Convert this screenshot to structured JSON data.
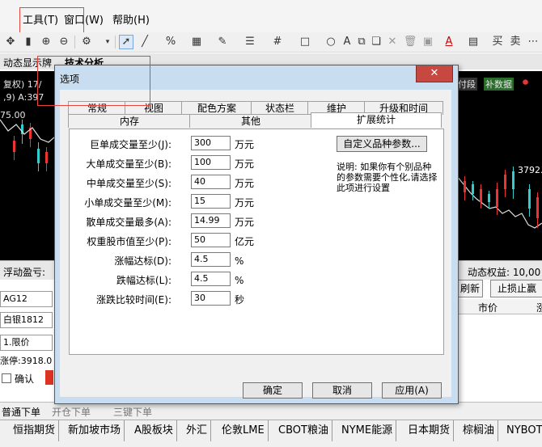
{
  "menu": {
    "tools": "工具(T)",
    "window": "窗口(W)",
    "help": "帮助(H)"
  },
  "toolbar": {
    "buttons": [
      "move-icon",
      "bars-icon",
      "zoom-in-icon",
      "zoom-out-icon",
      "settings-icon",
      "cursor-icon",
      "line-icon",
      "percent-icon",
      "ruler-icon",
      "pen-icon",
      "horizontal-lines-icon",
      "grid-icon",
      "rectangle-icon",
      "circle-icon",
      "text-icon",
      "copy-icon",
      "delete-icon",
      "trash-icon",
      "font-color-icon",
      "save-icon"
    ],
    "right_labels": [
      "买",
      "卖"
    ]
  },
  "app_tabs": {
    "dynamic": "动态显示牌",
    "technical": "技术分析"
  },
  "chart": {
    "header_left": "复权) 17/",
    "header_left2": ",9) A:397",
    "price_left": "75.00",
    "price_right": "3792.",
    "right_badge1": "付段",
    "right_badge2": "补数据"
  },
  "trade_panel": {
    "floating_pnl": "浮动盈亏:",
    "dynamic_equity": "动态权益: 10,00",
    "contract": "AG12",
    "contract_name": "白银1812",
    "order_type": "1.限价",
    "limit_down": "涨停:3918.0",
    "confirm": "确认",
    "refresh": "刷新",
    "stop_loss": "止损止赢",
    "col_market": "市价",
    "col_extra": "涨",
    "bottom_tab_normal": "普通下单",
    "bottom_tab2": "开仓下单",
    "bottom_tab3": "三键下单"
  },
  "market_tabs": [
    "恒指期货",
    "新加坡市场",
    "A股板块",
    "外汇",
    "伦敦LME",
    "CBOT粮油",
    "NYME能源",
    "日本期货",
    "棕榈油",
    "NYBOT"
  ],
  "dialog": {
    "title": "选项",
    "close": "✕",
    "tabs_row1": [
      "常规",
      "视图",
      "配色方案",
      "状态栏",
      "维护",
      "升级和时间"
    ],
    "tabs_row2": [
      "内存",
      "其他",
      "扩展统计"
    ],
    "active_tab": "扩展统计",
    "fields": [
      {
        "label": "巨单成交量至少(J):",
        "value": "300",
        "unit": "万元"
      },
      {
        "label": "大单成交量至少(B):",
        "value": "100",
        "unit": "万元"
      },
      {
        "label": "中单成交量至少(S):",
        "value": "40",
        "unit": "万元"
      },
      {
        "label": "小单成交量至少(M):",
        "value": "15",
        "unit": "万元"
      },
      {
        "label": "散单成交量最多(A):",
        "value": "14.99",
        "unit": "万元"
      },
      {
        "label": "权重股市值至少(P):",
        "value": "50",
        "unit": "亿元"
      },
      {
        "label": "涨幅达标(D):",
        "value": "4.5",
        "unit": "%"
      },
      {
        "label": "跌幅达标(L):",
        "value": "4.5",
        "unit": "%"
      },
      {
        "label": "涨跌比较时间(E):",
        "value": "30",
        "unit": "秒"
      }
    ],
    "custom_params_button": "自定义品种参数...",
    "description": "说明: 如果你有个别品种的参数需要个性化,请选择此项进行设置",
    "ok": "确定",
    "cancel": "取消",
    "apply": "应用(A)"
  }
}
